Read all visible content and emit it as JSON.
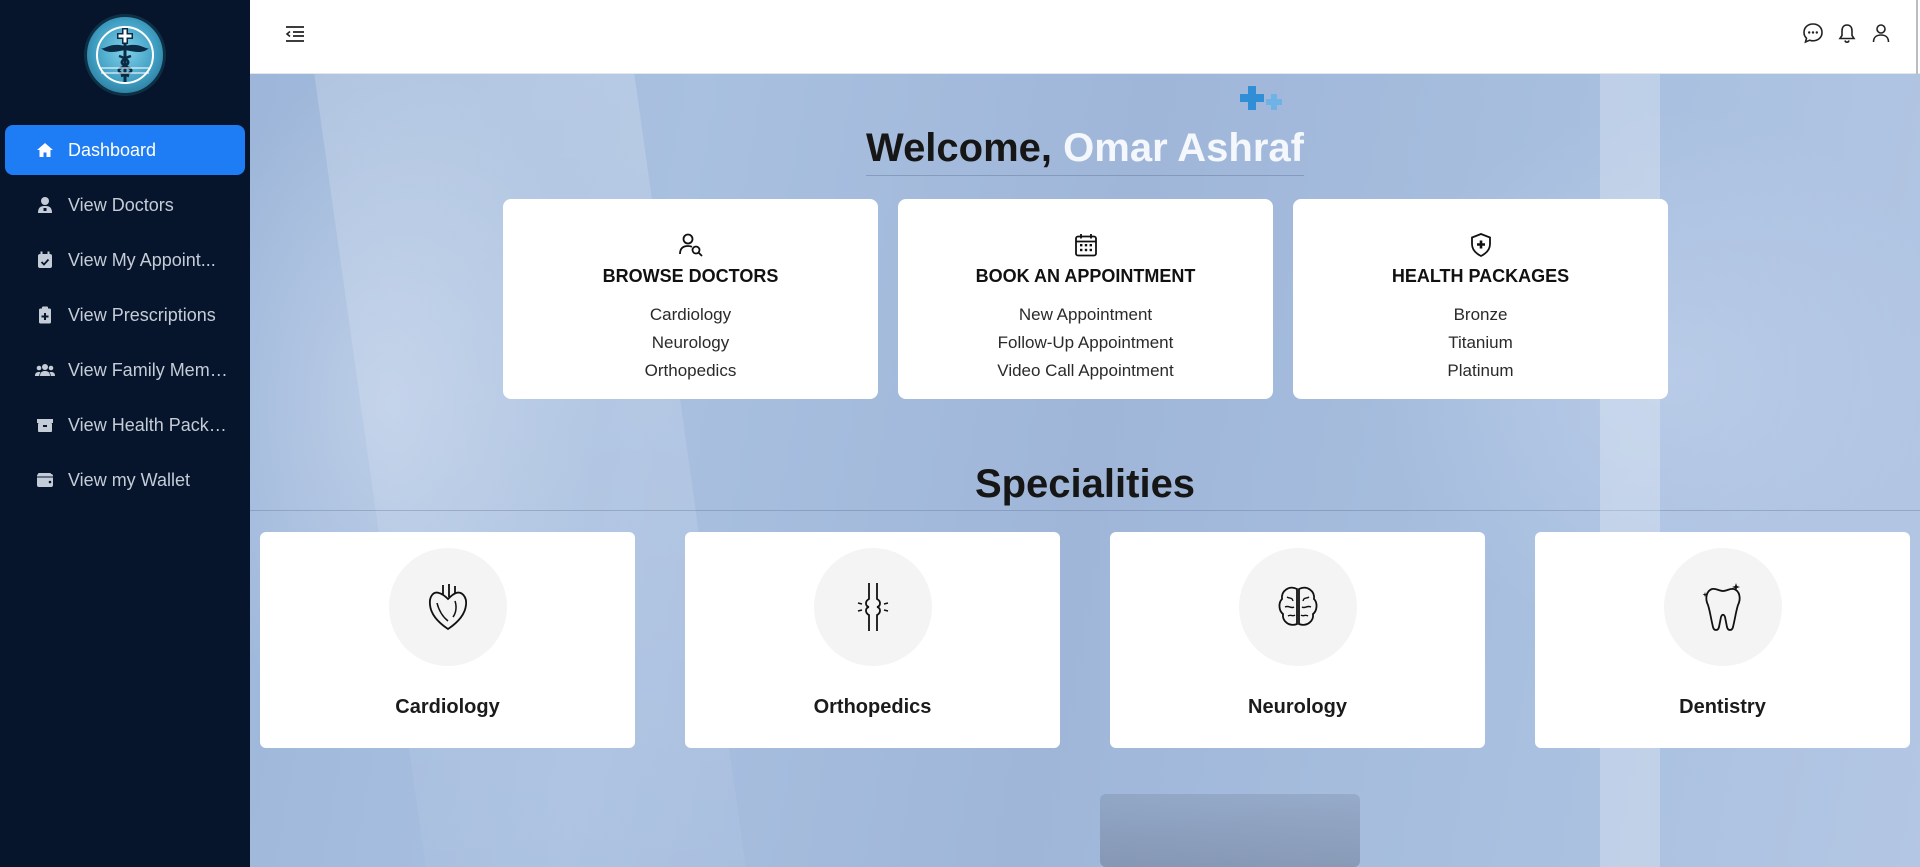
{
  "sidebar": {
    "logo_icon": "caduceus-logo",
    "items": [
      {
        "label": "Dashboard",
        "icon": "home-icon",
        "active": true
      },
      {
        "label": "View Doctors",
        "icon": "doctor-icon"
      },
      {
        "label": "View My Appoint...",
        "icon": "calendar-check-icon"
      },
      {
        "label": "View Prescriptions",
        "icon": "clipboard-icon"
      },
      {
        "label": "View Family Memb...",
        "icon": "users-icon"
      },
      {
        "label": "View Health Packa...",
        "icon": "box-icon"
      },
      {
        "label": "View my Wallet",
        "icon": "wallet-icon"
      }
    ]
  },
  "header": {
    "icons": [
      "menu-toggle-icon",
      "chat-icon",
      "bell-icon",
      "user-icon"
    ]
  },
  "welcome": {
    "prefix": "Welcome, ",
    "name": "Omar Ashraf"
  },
  "action_cards": [
    {
      "title": "BROWSE DOCTORS",
      "icon": "user-search-icon",
      "items": [
        "Cardiology",
        "Neurology",
        "Orthopedics"
      ]
    },
    {
      "title": "BOOK AN APPOINTMENT",
      "icon": "calendar-icon",
      "items": [
        "New Appointment",
        "Follow-Up Appointment",
        "Video Call Appointment"
      ]
    },
    {
      "title": "HEALTH PACKAGES",
      "icon": "shield-plus-icon",
      "items": [
        "Bronze",
        "Titanium",
        "Platinum"
      ]
    }
  ],
  "specialities": {
    "title": "Specialities",
    "items": [
      {
        "name": "Cardiology",
        "icon": "heart-icon"
      },
      {
        "name": "Orthopedics",
        "icon": "bone-joint-icon"
      },
      {
        "name": "Neurology",
        "icon": "brain-icon"
      },
      {
        "name": "Dentistry",
        "icon": "tooth-icon"
      }
    ]
  },
  "colors": {
    "sidebar_bg": "#06152b",
    "active_item": "#1e7cf5",
    "welcome_name": "#f4f7fb",
    "hero_bg": "#a9c0e0"
  }
}
